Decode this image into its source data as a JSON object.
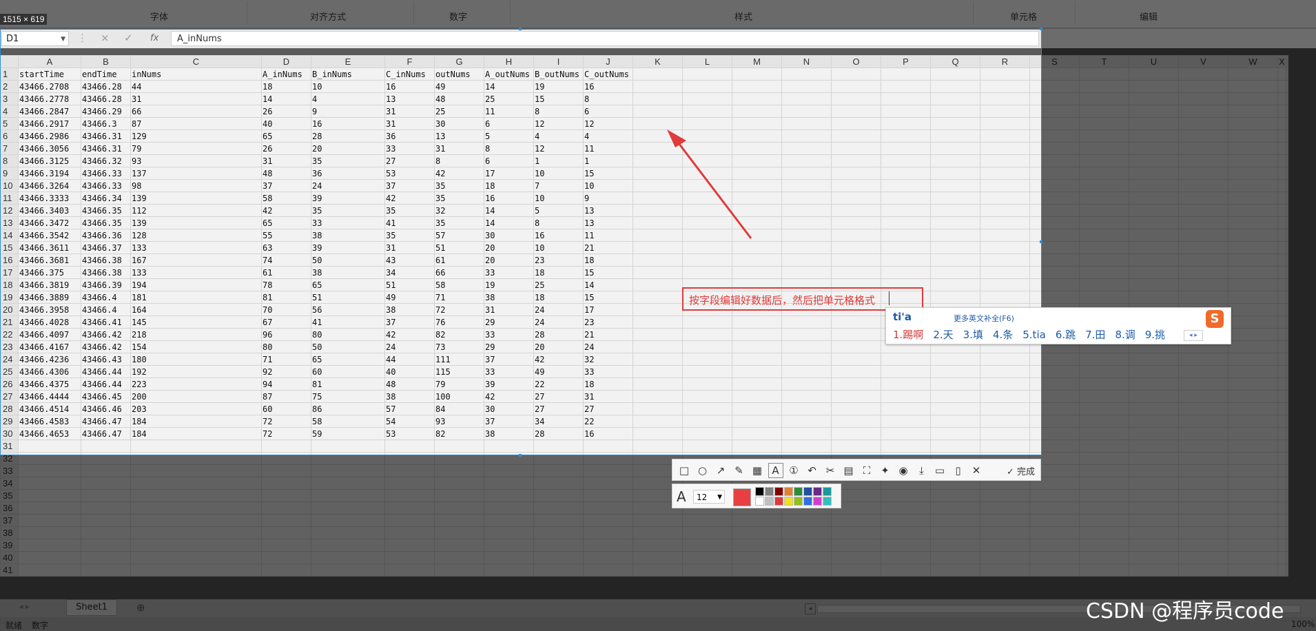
{
  "ribbon": {
    "groups": [
      "字体",
      "对齐方式",
      "数字",
      "样式",
      "单元格",
      "编辑"
    ],
    "size_badge": "1515 × 619"
  },
  "formula_bar": {
    "name_box": "D1",
    "cancel_icon": "×",
    "confirm_icon": "✓",
    "fx_icon": "fx",
    "content": "A_inNums"
  },
  "columns": [
    "A",
    "B",
    "C",
    "D",
    "E",
    "F",
    "G",
    "H",
    "I",
    "J",
    "K",
    "L",
    "M",
    "N",
    "O",
    "P",
    "Q",
    "R",
    "S",
    "T",
    "U",
    "V",
    "W",
    "X"
  ],
  "header_row": [
    "startTime",
    "endTime",
    "inNums",
    "A_inNums",
    "B_inNums",
    "C_inNums",
    "outNums",
    "A_outNums",
    "B_outNums",
    "C_outNums"
  ],
  "rows": [
    [
      "43466.2708",
      "43466.28",
      "44",
      "18",
      "10",
      "16",
      "49",
      "14",
      "19",
      "16"
    ],
    [
      "43466.2778",
      "43466.28",
      "31",
      "14",
      "4",
      "13",
      "48",
      "25",
      "15",
      "8"
    ],
    [
      "43466.2847",
      "43466.29",
      "66",
      "26",
      "9",
      "31",
      "25",
      "11",
      "8",
      "6"
    ],
    [
      "43466.2917",
      "43466.3",
      "87",
      "40",
      "16",
      "31",
      "30",
      "6",
      "12",
      "12"
    ],
    [
      "43466.2986",
      "43466.31",
      "129",
      "65",
      "28",
      "36",
      "13",
      "5",
      "4",
      "4"
    ],
    [
      "43466.3056",
      "43466.31",
      "79",
      "26",
      "20",
      "33",
      "31",
      "8",
      "12",
      "11"
    ],
    [
      "43466.3125",
      "43466.32",
      "93",
      "31",
      "35",
      "27",
      "8",
      "6",
      "1",
      "1"
    ],
    [
      "43466.3194",
      "43466.33",
      "137",
      "48",
      "36",
      "53",
      "42",
      "17",
      "10",
      "15"
    ],
    [
      "43466.3264",
      "43466.33",
      "98",
      "37",
      "24",
      "37",
      "35",
      "18",
      "7",
      "10"
    ],
    [
      "43466.3333",
      "43466.34",
      "139",
      "58",
      "39",
      "42",
      "35",
      "16",
      "10",
      "9"
    ],
    [
      "43466.3403",
      "43466.35",
      "112",
      "42",
      "35",
      "35",
      "32",
      "14",
      "5",
      "13"
    ],
    [
      "43466.3472",
      "43466.35",
      "139",
      "65",
      "33",
      "41",
      "35",
      "14",
      "8",
      "13"
    ],
    [
      "43466.3542",
      "43466.36",
      "128",
      "55",
      "38",
      "35",
      "57",
      "30",
      "16",
      "11"
    ],
    [
      "43466.3611",
      "43466.37",
      "133",
      "63",
      "39",
      "31",
      "51",
      "20",
      "10",
      "21"
    ],
    [
      "43466.3681",
      "43466.38",
      "167",
      "74",
      "50",
      "43",
      "61",
      "20",
      "23",
      "18"
    ],
    [
      "43466.375",
      "43466.38",
      "133",
      "61",
      "38",
      "34",
      "66",
      "33",
      "18",
      "15"
    ],
    [
      "43466.3819",
      "43466.39",
      "194",
      "78",
      "65",
      "51",
      "58",
      "19",
      "25",
      "14"
    ],
    [
      "43466.3889",
      "43466.4",
      "181",
      "81",
      "51",
      "49",
      "71",
      "38",
      "18",
      "15"
    ],
    [
      "43466.3958",
      "43466.4",
      "164",
      "70",
      "56",
      "38",
      "72",
      "31",
      "24",
      "17"
    ],
    [
      "43466.4028",
      "43466.41",
      "145",
      "67",
      "41",
      "37",
      "76",
      "29",
      "24",
      "23"
    ],
    [
      "43466.4097",
      "43466.42",
      "218",
      "96",
      "80",
      "42",
      "82",
      "33",
      "28",
      "21"
    ],
    [
      "43466.4167",
      "43466.42",
      "154",
      "80",
      "50",
      "24",
      "73",
      "29",
      "20",
      "24"
    ],
    [
      "43466.4236",
      "43466.43",
      "180",
      "71",
      "65",
      "44",
      "111",
      "37",
      "42",
      "32"
    ],
    [
      "43466.4306",
      "43466.44",
      "192",
      "92",
      "60",
      "40",
      "115",
      "33",
      "49",
      "33"
    ],
    [
      "43466.4375",
      "43466.44",
      "223",
      "94",
      "81",
      "48",
      "79",
      "39",
      "22",
      "18"
    ],
    [
      "43466.4444",
      "43466.45",
      "200",
      "87",
      "75",
      "38",
      "100",
      "42",
      "27",
      "31"
    ],
    [
      "43466.4514",
      "43466.46",
      "203",
      "60",
      "86",
      "57",
      "84",
      "30",
      "27",
      "27"
    ],
    [
      "43466.4583",
      "43466.47",
      "184",
      "72",
      "58",
      "54",
      "93",
      "37",
      "34",
      "22"
    ],
    [
      "43466.4653",
      "43466.47",
      "184",
      "72",
      "59",
      "53",
      "82",
      "38",
      "28",
      "16"
    ]
  ],
  "empty_row_numbers": [
    "31",
    "32",
    "33",
    "34",
    "35",
    "36",
    "37",
    "38",
    "39",
    "40",
    "41"
  ],
  "annotation": {
    "text": "按字段编辑好数据后，然后把单元格格式",
    "color": "#e03a3a"
  },
  "ime": {
    "pinyin": "ti'a",
    "more": "更多英文补全(F6)",
    "logo": "S",
    "candidates": [
      "1.踢啊",
      "2.天",
      "3.填",
      "4.条",
      "5.tia",
      "6.跳",
      "7.田",
      "8.调",
      "9.挑"
    ],
    "pager": "◂ ▸"
  },
  "screenshot_toolbar": {
    "tools": [
      "rect-icon",
      "ellipse-icon",
      "arrow-icon",
      "pen-icon",
      "mosaic-icon",
      "text-icon",
      "number-icon",
      "undo-icon",
      "pin-icon",
      "ocr-icon",
      "translate-icon",
      "magic-icon",
      "record-icon",
      "download-icon",
      "copy-icon",
      "bookmark-icon",
      "close-icon"
    ],
    "tool_glyphs": [
      "□",
      "○",
      "↗",
      "✎",
      "▦",
      "A",
      "①",
      "↶",
      "✂",
      "▤",
      "⛶",
      "✦",
      "◉",
      "⤓",
      "▭",
      "▯",
      "✕"
    ],
    "done_label": "完成",
    "done_glyph": "✓",
    "font_size": "12",
    "current_color": "#e84040",
    "palette": [
      "#000000",
      "#808080",
      "#800000",
      "#e08030",
      "#2e8b3a",
      "#2050a0",
      "#6a2a8a",
      "#1a9a9a",
      "#ffffff",
      "#c0c0c0",
      "#e03a3a",
      "#f0e020",
      "#90c020",
      "#3070e0",
      "#d040d0",
      "#30c0c0"
    ]
  },
  "sheet_tabs": [
    "Sheet1"
  ],
  "add_sheet": "⊕",
  "status": [
    "就绪",
    "数字"
  ],
  "zoom": "100%",
  "watermark": "CSDN @程序员code"
}
